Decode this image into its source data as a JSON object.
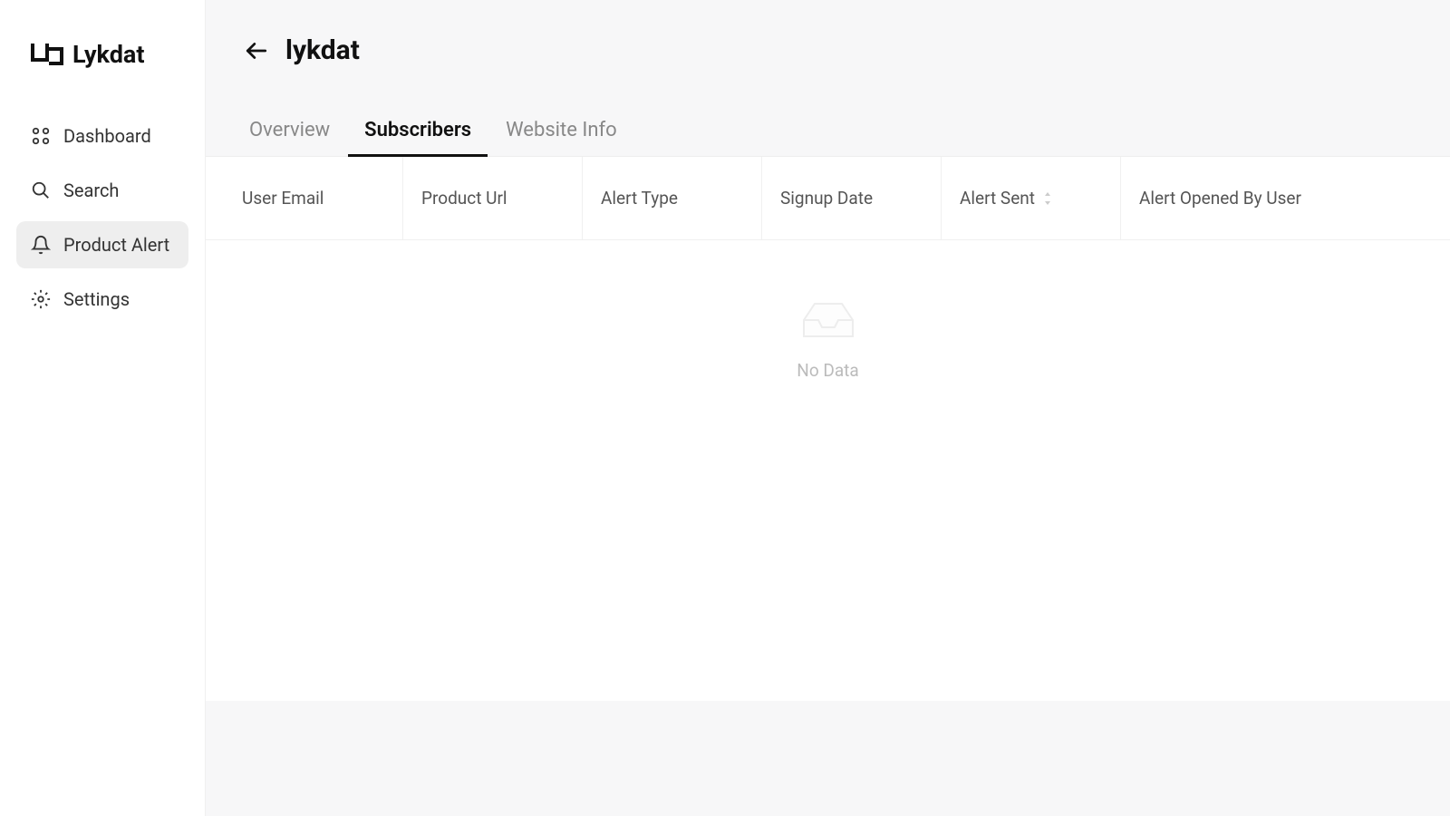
{
  "brand": {
    "name": "Lykdat"
  },
  "sidebar": {
    "items": [
      {
        "label": "Dashboard",
        "active": false
      },
      {
        "label": "Search",
        "active": false
      },
      {
        "label": "Product Alert",
        "active": true
      },
      {
        "label": "Settings",
        "active": false
      }
    ]
  },
  "header": {
    "title": "lykdat"
  },
  "tabs": [
    {
      "label": "Overview",
      "active": false
    },
    {
      "label": "Subscribers",
      "active": true
    },
    {
      "label": "Website Info",
      "active": false
    }
  ],
  "table": {
    "columns": [
      {
        "label": "User Email"
      },
      {
        "label": "Product Url"
      },
      {
        "label": "Alert Type"
      },
      {
        "label": "Signup Date"
      },
      {
        "label": "Alert Sent",
        "sortable": true
      },
      {
        "label": "Alert Opened By User"
      }
    ],
    "empty_message": "No Data"
  }
}
